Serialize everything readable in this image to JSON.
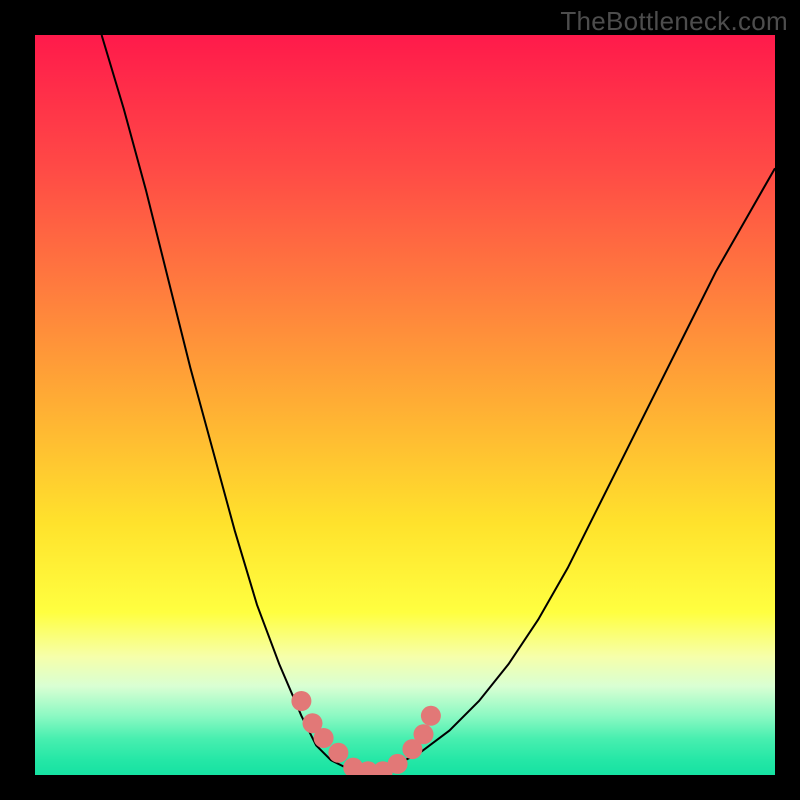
{
  "watermark": "TheBottleneck.com",
  "colors": {
    "background": "#000000",
    "gradient_top": "#ff1a4b",
    "gradient_bottom": "#16e2a2",
    "curve": "#000000",
    "marker": "#e27877"
  },
  "chart_data": {
    "type": "line",
    "title": "",
    "xlabel": "",
    "ylabel": "",
    "xlim": [
      0,
      100
    ],
    "ylim": [
      0,
      100
    ],
    "grid": false,
    "note": "Axes are unlabeled; values estimated from curve geometry. y is bottleneck percentage (0 at bottom / green, 100 at top / red). x is an unlabeled sweep parameter.",
    "series": [
      {
        "name": "left-branch",
        "x": [
          9,
          12,
          15,
          18,
          21,
          24,
          27,
          30,
          33,
          36,
          38,
          40,
          42,
          44
        ],
        "y": [
          100,
          90,
          79,
          67,
          55,
          44,
          33,
          23,
          15,
          8,
          4,
          2,
          1,
          0
        ]
      },
      {
        "name": "right-branch",
        "x": [
          44,
          48,
          52,
          56,
          60,
          64,
          68,
          72,
          76,
          80,
          84,
          88,
          92,
          96,
          100
        ],
        "y": [
          0,
          1,
          3,
          6,
          10,
          15,
          21,
          28,
          36,
          44,
          52,
          60,
          68,
          75,
          82
        ]
      }
    ],
    "markers": {
      "name": "highlighted-points",
      "x": [
        36,
        37.5,
        39,
        41,
        43,
        45,
        47,
        49,
        51,
        52.5,
        53.5
      ],
      "y": [
        10,
        7,
        5,
        3,
        1,
        0.5,
        0.5,
        1.5,
        3.5,
        5.5,
        8
      ]
    }
  }
}
